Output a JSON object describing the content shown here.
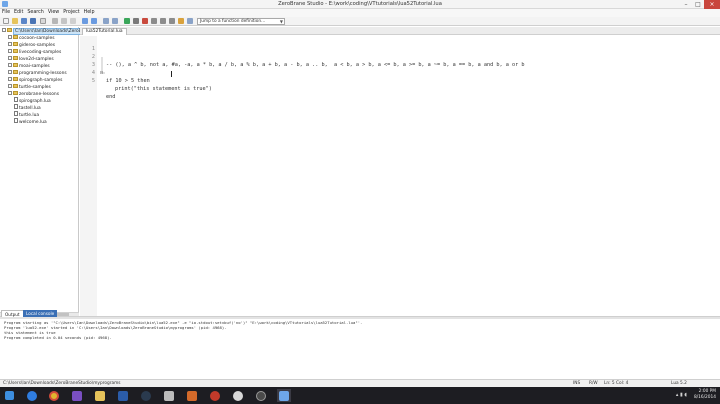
{
  "window": {
    "title": "ZeroBrane Studio - E:\\work\\coding\\VTtutorials\\lua52Tutorial.lua"
  },
  "menu": [
    "File",
    "Edit",
    "Search",
    "View",
    "Project",
    "Help"
  ],
  "toolbar": {
    "function_jump_placeholder": "Jump to a function definition..."
  },
  "project_tree": [
    {
      "label": "C:\\Users\\Ian\\Downloads\\ZeroBra",
      "type": "root"
    },
    {
      "label": "cocoon-samples",
      "type": "folder"
    },
    {
      "label": "gideros-samples",
      "type": "folder"
    },
    {
      "label": "livecoding-samples",
      "type": "folder"
    },
    {
      "label": "love2d-samples",
      "type": "folder"
    },
    {
      "label": "moai-samples",
      "type": "folder"
    },
    {
      "label": "programming-lessons",
      "type": "folder"
    },
    {
      "label": "spirograph-samples",
      "type": "folder"
    },
    {
      "label": "turtle-samples",
      "type": "folder"
    },
    {
      "label": "zerobrane-lessons",
      "type": "folder"
    },
    {
      "label": "spirograph.lua",
      "type": "file"
    },
    {
      "label": "tastell.lua",
      "type": "file"
    },
    {
      "label": "turtle.lua",
      "type": "file"
    },
    {
      "label": "welcome.lua",
      "type": "file"
    }
  ],
  "editor": {
    "tab_label": "lua52Tutorial.lua",
    "lines": [
      {
        "num": "1",
        "fold": "",
        "text": "-- (), a ^ b, not a, #a, -a, a * b, a / b, a % b, a + b, a - b, a .. b,  a < b, a > b, a <= b, a >= b, a ~= b, a == b, a and b, a or b",
        "indent": false
      },
      {
        "num": "2",
        "fold": "",
        "text": "",
        "indent": false
      },
      {
        "num": "3",
        "fold": "⊟",
        "text": "if 10 > 5 then",
        "indent": false
      },
      {
        "num": "4",
        "fold": "",
        "text": "print(\"this statement is true\")",
        "indent": true
      },
      {
        "num": "5",
        "fold": "",
        "text": "end",
        "indent": false
      }
    ]
  },
  "output_tabs": {
    "output": "Output",
    "console": "Local console"
  },
  "output": [
    "Program starting as '\"C:\\Users\\Ian\\Downloads\\ZeroBraneStudio\\bin\\lua52.exe\" -e \"io.stdout:setvbuf('no')\" \"E:\\work\\coding\\VTtutorials\\lua52Tutorial.lua\"'.",
    "Program 'lua52.exe' started in 'C:\\Users\\Ian\\Downloads\\ZeroBraneStudio\\myprograms' (pid: 4968).",
    "this statement is true",
    "Program completed in 0.04 seconds (pid: 4968)."
  ],
  "status": {
    "path": "C:\\Users\\Ian\\Downloads\\ZeroBraneStudio\\myprograms",
    "ins": "INS",
    "rw": "R/W",
    "position": "Ln: 5 Col: 4",
    "interpreter": "Lua 5.2"
  },
  "taskbar": {
    "time": "2:00 PM",
    "date": "8/16/2014"
  },
  "colors": {
    "accent": "#3a6fb5",
    "close": "#c9463d",
    "taskbar": "#1d1d22"
  }
}
